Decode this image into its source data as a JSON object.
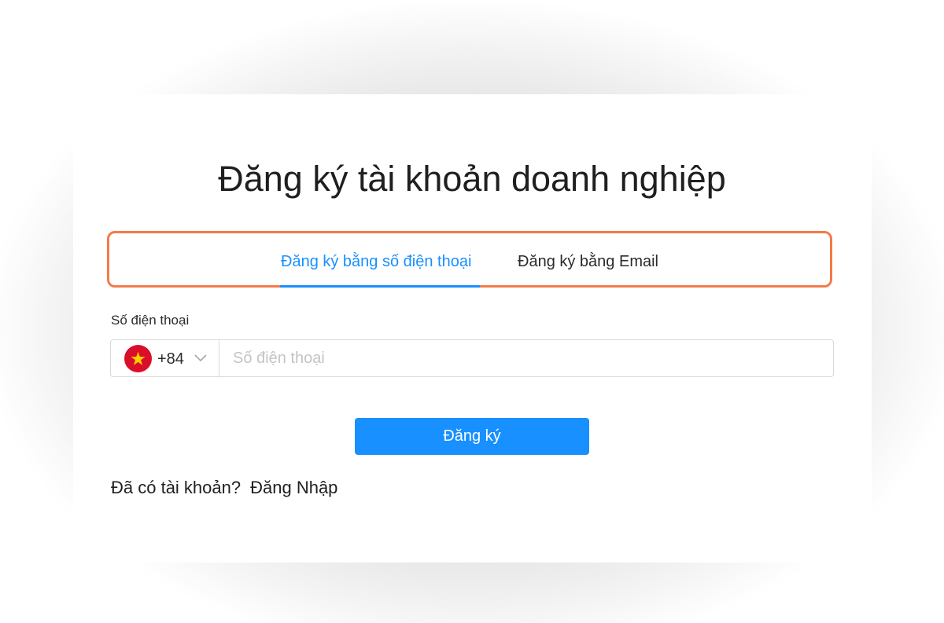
{
  "page": {
    "title": "Đăng ký tài khoản doanh nghiệp"
  },
  "tabs": [
    {
      "label": "Đăng ký bằng số điện thoại",
      "active": true
    },
    {
      "label": "Đăng ký bằng Email",
      "active": false
    }
  ],
  "phone_field": {
    "label": "Số điện thoại",
    "country_flag": "vietnam-flag-icon",
    "dial_code": "+84",
    "value": "",
    "placeholder": "Số điện thoại"
  },
  "submit_button": {
    "label": "Đăng ký"
  },
  "login_prompt": {
    "text": "Đã có tài khoản?",
    "link_label": "Đăng Nhập"
  },
  "colors": {
    "accent": "#1890ff",
    "highlight_border": "#f47b48",
    "flag_red": "#da0e2a",
    "flag_star": "#ffcd00"
  }
}
